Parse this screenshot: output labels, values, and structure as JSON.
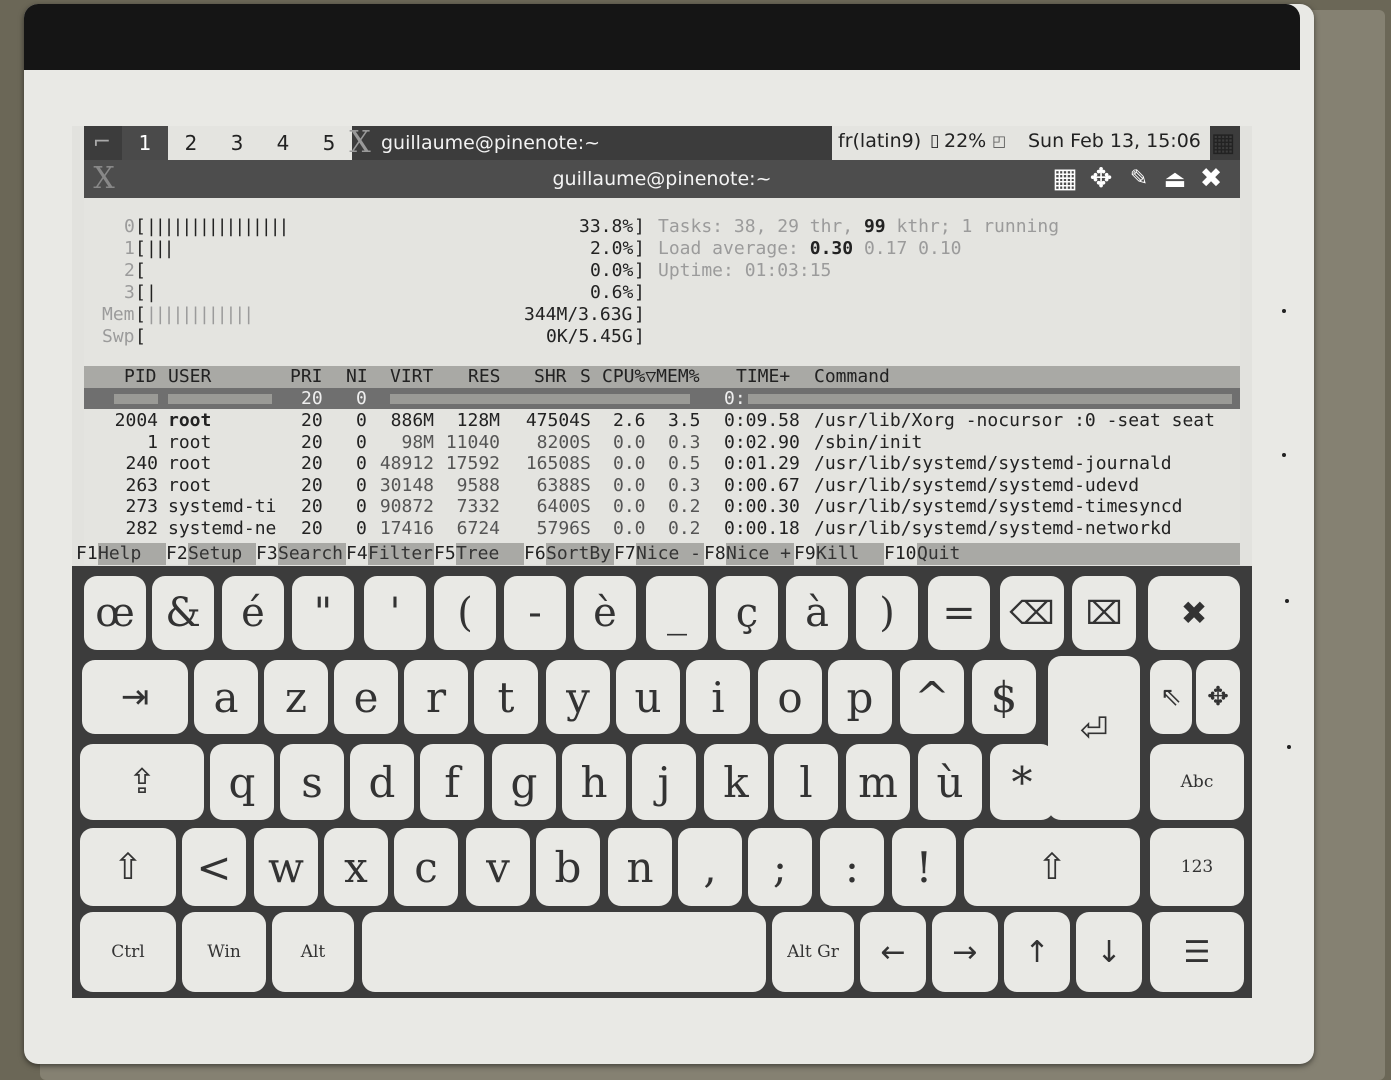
{
  "panel": {
    "workspaces": [
      "1",
      "2",
      "3",
      "4",
      "5"
    ],
    "active_workspace": "1",
    "title": "guillaume@pinenote:~",
    "keyboard_layout": "fr(latin9)",
    "battery": "22%",
    "clock": "Sun Feb 13, 15:06"
  },
  "window": {
    "title": "guillaume@pinenote:~"
  },
  "htop": {
    "meters": [
      {
        "label": "0",
        "bars": "||||||||||||||||",
        "value": "33.8%"
      },
      {
        "label": "1",
        "bars": "|||",
        "value": "2.0%"
      },
      {
        "label": "2",
        "bars": "",
        "value": "0.0%"
      },
      {
        "label": "3",
        "bars": "|",
        "value": "0.6%"
      },
      {
        "label": "Mem",
        "bars": "||||||||||||",
        "value": "344M/3.63G"
      },
      {
        "label": "Swp",
        "bars": "",
        "value": "0K/5.45G"
      }
    ],
    "tasks": {
      "label": "Tasks:",
      "tasks": "38",
      "thr": "29 thr,",
      "kthr": "99",
      "kthr_label": "kthr;",
      "running": "1",
      "running_label": "running"
    },
    "load": {
      "label": "Load average:",
      "v1": "0.30",
      "v2": "0.17",
      "v3": "0.10"
    },
    "uptime": {
      "label": "Uptime:",
      "value": "01:03:15"
    },
    "header": {
      "pid": "PID",
      "user": "USER",
      "pri": "PRI",
      "ni": "NI",
      "virt": "VIRT",
      "res": "RES",
      "shr": "SHR",
      "s": "S",
      "cpu": "CPU%▽MEM%",
      "time": "TIME+",
      "command": "Command"
    },
    "rows": [
      {
        "pid": "2004",
        "user": "root",
        "pri": "20",
        "ni": "0",
        "virt": "886M",
        "res": "128M",
        "shr": "47504",
        "s": "S",
        "cpu": "2.6",
        "mem": "3.5",
        "time": "0:09.58",
        "command": "/usr/lib/Xorg -nocursor :0 -seat seat"
      },
      {
        "pid": "1",
        "user": "root",
        "pri": "20",
        "ni": "0",
        "virt": "98M",
        "res": "11040",
        "shr": "8200",
        "s": "S",
        "cpu": "0.0",
        "mem": "0.3",
        "time": "0:02.90",
        "command": "/sbin/init"
      },
      {
        "pid": "240",
        "user": "root",
        "pri": "20",
        "ni": "0",
        "virt": "48912",
        "res": "17592",
        "shr": "16508",
        "s": "S",
        "cpu": "0.0",
        "mem": "0.5",
        "time": "0:01.29",
        "command": "/usr/lib/systemd/systemd-journald"
      },
      {
        "pid": "263",
        "user": "root",
        "pri": "20",
        "ni": "0",
        "virt": "30148",
        "res": "9588",
        "shr": "6388",
        "s": "S",
        "cpu": "0.0",
        "mem": "0.3",
        "time": "0:00.67",
        "command": "/usr/lib/systemd/systemd-udevd"
      },
      {
        "pid": "273",
        "user": "systemd-ti",
        "pri": "20",
        "ni": "0",
        "virt": "90872",
        "res": "7332",
        "shr": "6400",
        "s": "S",
        "cpu": "0.0",
        "mem": "0.2",
        "time": "0:00.30",
        "command": "/usr/lib/systemd/systemd-timesyncd"
      },
      {
        "pid": "282",
        "user": "systemd-ne",
        "pri": "20",
        "ni": "0",
        "virt": "17416",
        "res": "6724",
        "shr": "5796",
        "s": "S",
        "cpu": "0.0",
        "mem": "0.2",
        "time": "0:00.18",
        "command": "/usr/lib/systemd/systemd-networkd"
      }
    ],
    "selected_row": {
      "pri": "20",
      "ni": "0",
      "time": "0:"
    },
    "fkeys": [
      {
        "key": "F1",
        "label": "Help"
      },
      {
        "key": "F2",
        "label": "Setup"
      },
      {
        "key": "F3",
        "label": "Search"
      },
      {
        "key": "F4",
        "label": "Filter"
      },
      {
        "key": "F5",
        "label": "Tree"
      },
      {
        "key": "F6",
        "label": "SortBy"
      },
      {
        "key": "F7",
        "label": "Nice -"
      },
      {
        "key": "F8",
        "label": "Nice +"
      },
      {
        "key": "F9",
        "label": "Kill"
      },
      {
        "key": "F10",
        "label": "Quit"
      }
    ]
  },
  "keyboard": {
    "row1": [
      "œ",
      "&",
      "é",
      "\"",
      "'",
      "(",
      "-",
      "è",
      "_",
      "ç",
      "à",
      ")",
      "="
    ],
    "row1_icons": {
      "backspace": "⌫",
      "delete": "⌧",
      "close": "✖"
    },
    "row2": [
      "a",
      "z",
      "e",
      "r",
      "t",
      "y",
      "u",
      "i",
      "o",
      "p",
      "^",
      "$"
    ],
    "row2_icons": {
      "tab": "⇥",
      "pointer": "⇖",
      "move": "✥",
      "enter": "⏎"
    },
    "row3": [
      "q",
      "s",
      "d",
      "f",
      "g",
      "h",
      "j",
      "k",
      "l",
      "m",
      "ù",
      "*"
    ],
    "row3_icons": {
      "capslock": "⇪"
    },
    "row3_mode": "Abc",
    "row4": [
      "<",
      "w",
      "x",
      "c",
      "v",
      "b",
      "n",
      ",",
      ";",
      ":",
      "!"
    ],
    "row4_icons": {
      "shift": "⇧"
    },
    "row4_mode": "123",
    "row5": {
      "ctrl": "Ctrl",
      "win": "Win",
      "alt": "Alt",
      "altgr": "Alt Gr",
      "left": "←",
      "right": "→",
      "up": "↑",
      "down": "↓",
      "menu": "☰"
    }
  }
}
